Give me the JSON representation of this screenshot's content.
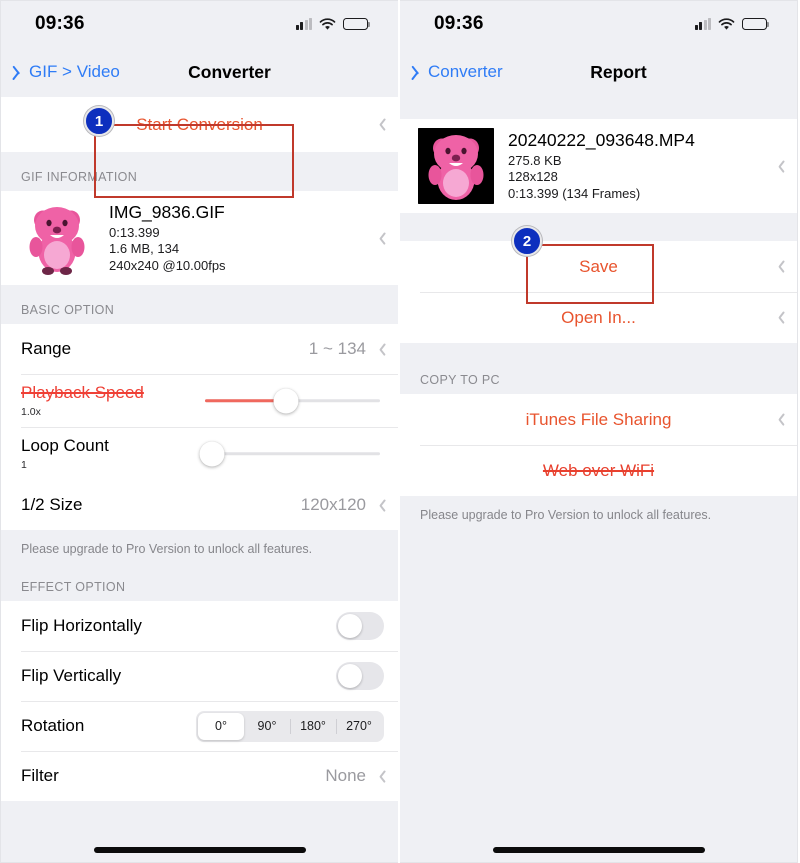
{
  "left_screen": {
    "status_bar": {
      "time": "09:36",
      "signal_icon": "cellular-signal-icon",
      "wifi_icon": "wifi-icon",
      "battery_icon": "battery-icon"
    },
    "nav": {
      "back_label": "GIF > Video",
      "title": "Converter",
      "back_icon": "chevron-left-icon"
    },
    "start_conversion": {
      "label": "Start Conversion"
    },
    "gif_information": {
      "header": "GIF INFORMATION",
      "file_name": "IMG_9836.GIF",
      "duration": "0:13.399",
      "size_frames": "1.6 MB, 134",
      "dimensions_fps": "240x240 @10.00fps"
    },
    "basic_option": {
      "header": "BASIC OPTION",
      "range": {
        "label": "Range",
        "value": "1 ~ 134"
      },
      "playback_speed": {
        "label": "Playback Speed",
        "value": "1.0x",
        "slider_percent": 46,
        "fill_percent": 46,
        "disabled": true
      },
      "loop_count": {
        "label": "Loop Count",
        "value": "1",
        "slider_percent": 4,
        "fill_percent": 0,
        "disabled": false
      },
      "half_size": {
        "label": "1/2 Size",
        "value": "120x120"
      }
    },
    "upgrade_note": "Please upgrade to Pro Version to unlock all features.",
    "effect_option": {
      "header": "EFFECT OPTION",
      "flip_horizontally": {
        "label": "Flip Horizontally",
        "state": "off"
      },
      "flip_vertically": {
        "label": "Flip Vertically",
        "state": "off"
      },
      "rotation": {
        "label": "Rotation",
        "options": [
          "0°",
          "90°",
          "180°",
          "270°"
        ],
        "selected_index": 0
      },
      "filter": {
        "label": "Filter",
        "value": "None"
      }
    },
    "annotation": {
      "badge_number": "1"
    }
  },
  "right_screen": {
    "status_bar": {
      "time": "09:36",
      "signal_icon": "cellular-signal-icon",
      "wifi_icon": "wifi-icon",
      "battery_icon": "battery-icon"
    },
    "nav": {
      "back_label": "Converter",
      "title": "Report",
      "back_icon": "chevron-left-icon"
    },
    "report_file": {
      "file_name": "20240222_093648.MP4",
      "size": "275.8 KB",
      "dimensions": "128x128",
      "duration_frames": "0:13.399 (134 Frames)"
    },
    "actions": {
      "save": "Save",
      "open_in": "Open In..."
    },
    "copy_to_pc": {
      "header": "COPY TO PC",
      "itunes_file_sharing": "iTunes File Sharing",
      "web_over_wifi": "Web over WiFi"
    },
    "upgrade_note": "Please upgrade to Pro Version to unlock all features.",
    "annotation": {
      "badge_number": "2"
    }
  },
  "colors": {
    "accent_orange": "#e8542e",
    "link_blue": "#2f7cf6",
    "annotation_red": "#c0392b",
    "badge_blue": "#0d2fbe",
    "slider_red": "#f0685e",
    "background_gray": "#eff0f4"
  }
}
